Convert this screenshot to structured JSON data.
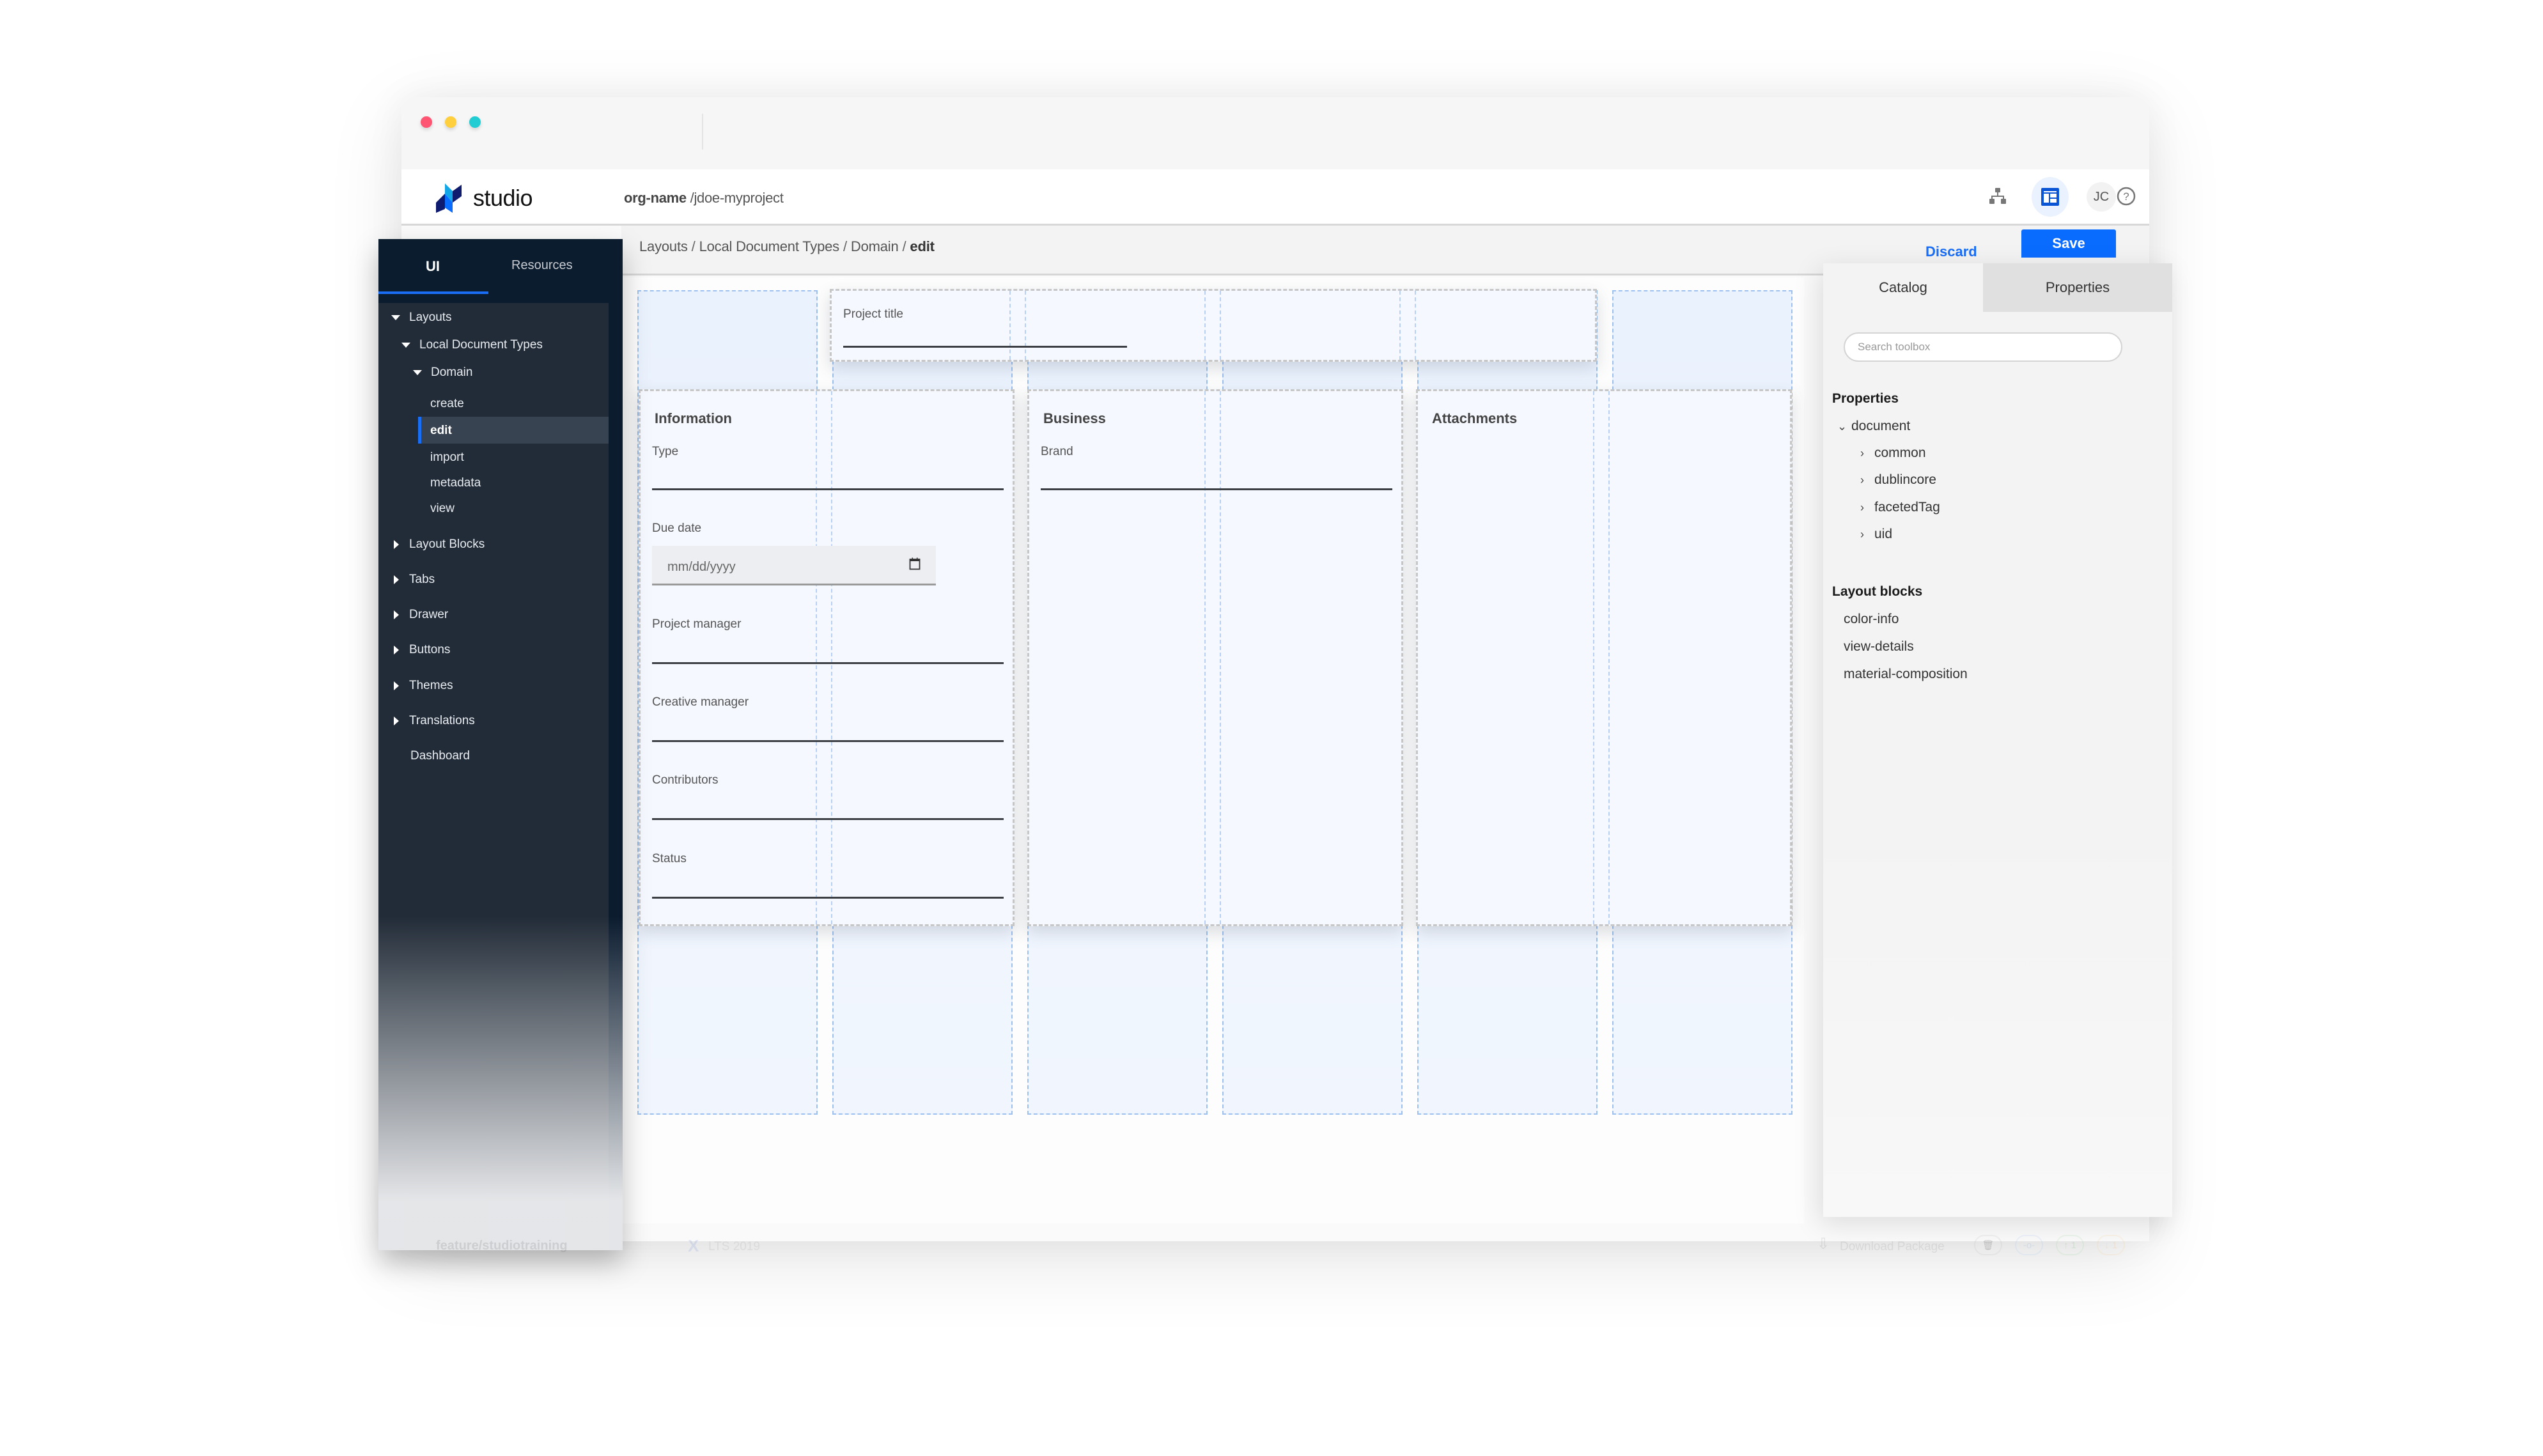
{
  "window": {
    "traffic_lights": [
      "close",
      "minimize",
      "maximize"
    ]
  },
  "header": {
    "brand": "studio",
    "org": "org-name",
    "project": "/jdoe-myproject",
    "icons": [
      "hierarchy-icon",
      "layout-icon",
      "help-icon",
      "apps-grid-icon"
    ],
    "avatar_initials": "JC",
    "colors": {
      "accent": "#0a6cff",
      "active_icon_bg": "#eaf2ff"
    }
  },
  "subbar": {
    "breadcrumb": [
      "Layouts",
      "Local Document Types",
      "Domain"
    ],
    "breadcrumb_current": "edit",
    "discard_label": "Discard",
    "save_label": "Save"
  },
  "sidebar": {
    "tabs": [
      {
        "label": "UI",
        "active": true
      },
      {
        "label": "Resources",
        "active": false
      }
    ],
    "tree": [
      {
        "label": "Layouts",
        "level": 0,
        "expanded": true
      },
      {
        "label": "Local Document Types",
        "level": 1,
        "expanded": true
      },
      {
        "label": "Domain",
        "level": 2,
        "expanded": true
      },
      {
        "label": "create",
        "level": 3
      },
      {
        "label": "edit",
        "level": 3,
        "selected": true
      },
      {
        "label": "import",
        "level": 3
      },
      {
        "label": "metadata",
        "level": 3
      },
      {
        "label": "view",
        "level": 3
      },
      {
        "label": "Layout Blocks",
        "level": 0,
        "expanded": false
      },
      {
        "label": "Tabs",
        "level": 0,
        "expanded": false
      },
      {
        "label": "Drawer",
        "level": 0,
        "expanded": false
      },
      {
        "label": "Buttons",
        "level": 0,
        "expanded": false
      },
      {
        "label": "Themes",
        "level": 0,
        "expanded": false
      },
      {
        "label": "Translations",
        "level": 0,
        "expanded": false
      },
      {
        "label": "Dashboard",
        "level": 0
      }
    ]
  },
  "canvas": {
    "title_block": {
      "label": "Project title"
    },
    "blocks": [
      {
        "title": "Information",
        "fields": [
          {
            "label": "Type",
            "type": "text"
          },
          {
            "label": "Due date",
            "type": "date",
            "placeholder": "mm/dd/yyyy"
          },
          {
            "label": "Project manager",
            "type": "text"
          },
          {
            "label": "Creative manager",
            "type": "text"
          },
          {
            "label": "Contributors",
            "type": "text"
          },
          {
            "label": "Status",
            "type": "text"
          }
        ]
      },
      {
        "title": "Business",
        "fields": [
          {
            "label": "Brand",
            "type": "text"
          }
        ]
      },
      {
        "title": "Attachments",
        "fields": []
      }
    ],
    "grid_columns": 6
  },
  "right_panel": {
    "tabs": [
      {
        "label": "Catalog",
        "active": true
      },
      {
        "label": "Properties",
        "active": false
      }
    ],
    "search_placeholder": "Search toolbox",
    "properties_heading": "Properties",
    "properties_tree": {
      "root": "document",
      "children": [
        "common",
        "dublincore",
        "facetedTag",
        "uid"
      ]
    },
    "layout_blocks_heading": "Layout blocks",
    "layout_blocks": [
      "color-info",
      "view-details",
      "material-composition"
    ]
  },
  "footer": {
    "branch": "feature/studiotraining",
    "version": "LTS 2019",
    "download_label": "Download Package",
    "pills": [
      {
        "icon": "trash-icon",
        "label": ""
      },
      {
        "icon": "commit-icon",
        "label": ""
      },
      {
        "icon": "push-icon",
        "label": "↑ 1"
      },
      {
        "icon": "pull-icon",
        "label": "↓ 1"
      }
    ]
  }
}
